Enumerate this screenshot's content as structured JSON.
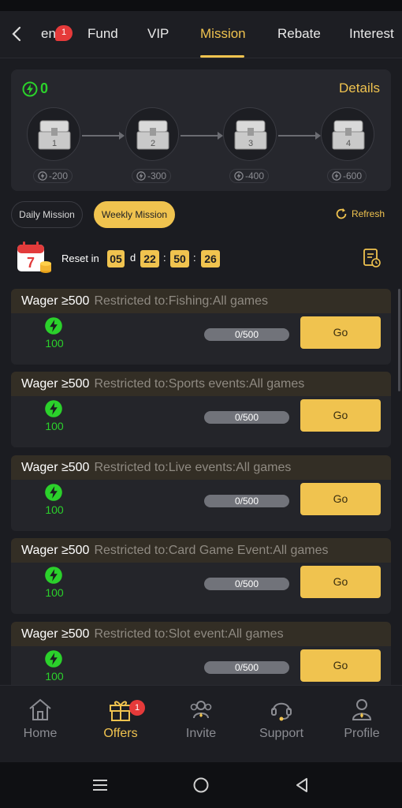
{
  "tabs": {
    "items": [
      {
        "label": "ent",
        "badge": "1"
      },
      {
        "label": "Fund"
      },
      {
        "label": "VIP"
      },
      {
        "label": "Mission",
        "active": true
      },
      {
        "label": "Rebate"
      },
      {
        "label": "Interest"
      }
    ]
  },
  "summary": {
    "energy": "0",
    "details_label": "Details",
    "chests": [
      {
        "number": "1",
        "cost": "-200"
      },
      {
        "number": "2",
        "cost": "-300"
      },
      {
        "number": "3",
        "cost": "-400"
      },
      {
        "number": "4",
        "cost": "-600"
      }
    ]
  },
  "filters": {
    "daily_label": "Daily Mission",
    "weekly_label": "Weekly Mission",
    "refresh_label": "Refresh"
  },
  "reset": {
    "label": "Reset in",
    "days": "05",
    "day_unit": "d",
    "hours": "22",
    "minutes": "50",
    "seconds": "26",
    "calendar_day": "7"
  },
  "missions": [
    {
      "title": "Wager ≥500",
      "restriction": "Restricted to:Fishing:All games",
      "reward": "100",
      "progress": "0/500",
      "action": "Go"
    },
    {
      "title": "Wager ≥500",
      "restriction": "Restricted to:Sports events:All games",
      "reward": "100",
      "progress": "0/500",
      "action": "Go"
    },
    {
      "title": "Wager ≥500",
      "restriction": "Restricted to:Live events:All games",
      "reward": "100",
      "progress": "0/500",
      "action": "Go"
    },
    {
      "title": "Wager ≥500",
      "restriction": "Restricted to:Card Game Event:All games",
      "reward": "100",
      "progress": "0/500",
      "action": "Go"
    },
    {
      "title": "Wager ≥500",
      "restriction": "Restricted to:Slot event:All games",
      "reward": "100",
      "progress": "0/500",
      "action": "Go"
    }
  ],
  "nav": {
    "items": [
      {
        "label": "Home",
        "icon": "home-icon"
      },
      {
        "label": "Offers",
        "icon": "gift-icon",
        "badge": "1",
        "active": true
      },
      {
        "label": "Invite",
        "icon": "invite-icon"
      },
      {
        "label": "Support",
        "icon": "headset-icon"
      },
      {
        "label": "Profile",
        "icon": "user-icon"
      }
    ]
  },
  "colors": {
    "accent": "#f0c34f",
    "energy_green": "#2bd12b",
    "background": "#1b1c21",
    "badge_red": "#e53a3a"
  }
}
